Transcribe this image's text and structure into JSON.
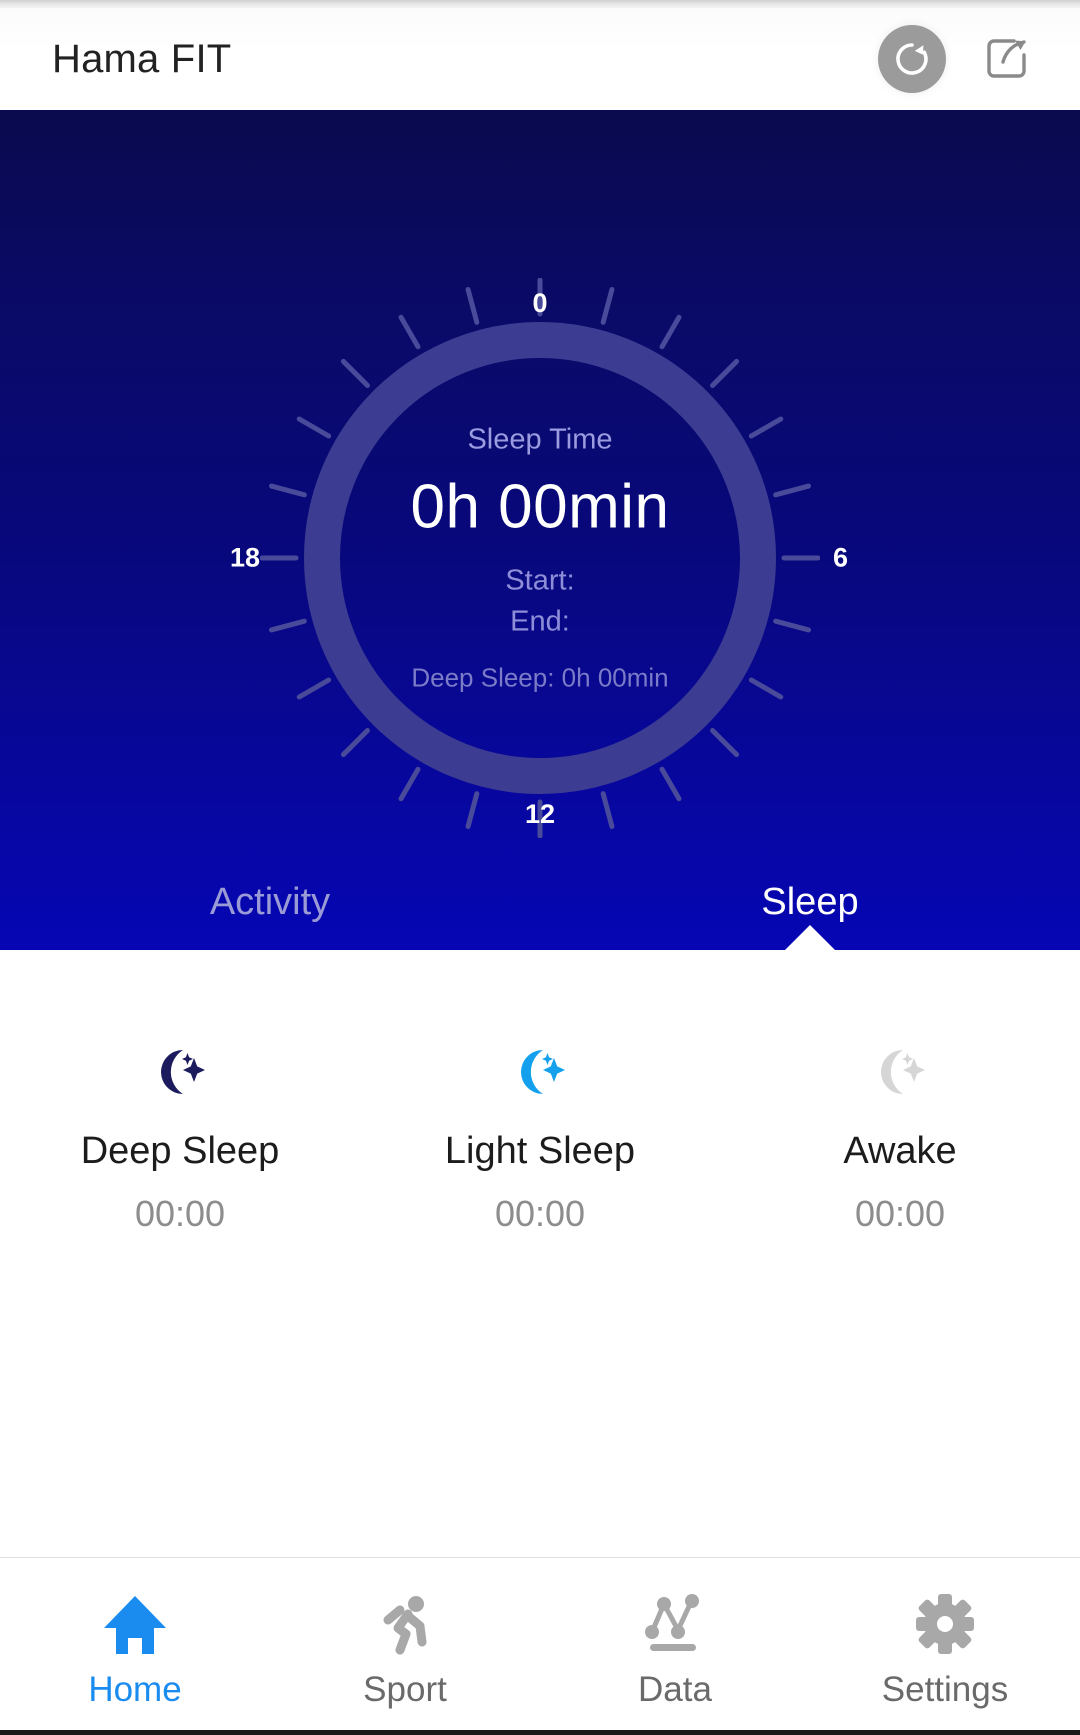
{
  "appbar": {
    "title": "Hama FIT",
    "sync_icon": "refresh-sync-icon",
    "share_icon": "share-export-icon"
  },
  "hero": {
    "dial": {
      "hour_labels": [
        "0",
        "6",
        "12",
        "18"
      ],
      "ring_color": "#3a3a8f",
      "tick_color": "#4a4a9b",
      "tick_count": 24
    },
    "sleep_time_label": "Sleep Time",
    "sleep_time_value": "0h 00min",
    "start_label": "Start:",
    "end_label": "End:",
    "deep_sleep_inline": "Deep Sleep: 0h 00min",
    "background_top_color": "#0a0a4e",
    "background_bottom_color": "#0606b4"
  },
  "hero_tabs": {
    "items": [
      {
        "label": "Activity",
        "active": false
      },
      {
        "label": "Sleep",
        "active": true
      }
    ]
  },
  "stats": {
    "items": [
      {
        "label": "Deep Sleep",
        "value": "00:00",
        "icon": "moon-stars-icon",
        "color": "#1b1b5e"
      },
      {
        "label": "Light Sleep",
        "value": "00:00",
        "icon": "moon-stars-icon",
        "color": "#14a0ec"
      },
      {
        "label": "Awake",
        "value": "00:00",
        "icon": "moon-stars-icon",
        "color": "#d6d6d6"
      }
    ]
  },
  "bottomnav": {
    "accent_color": "#1a8cf0",
    "inactive_color": "#a8a8a8",
    "items": [
      {
        "label": "Home",
        "icon": "home-icon",
        "active": true
      },
      {
        "label": "Sport",
        "icon": "running-icon",
        "active": false
      },
      {
        "label": "Data",
        "icon": "chart-icon",
        "active": false
      },
      {
        "label": "Settings",
        "icon": "gear-icon",
        "active": false
      }
    ]
  }
}
